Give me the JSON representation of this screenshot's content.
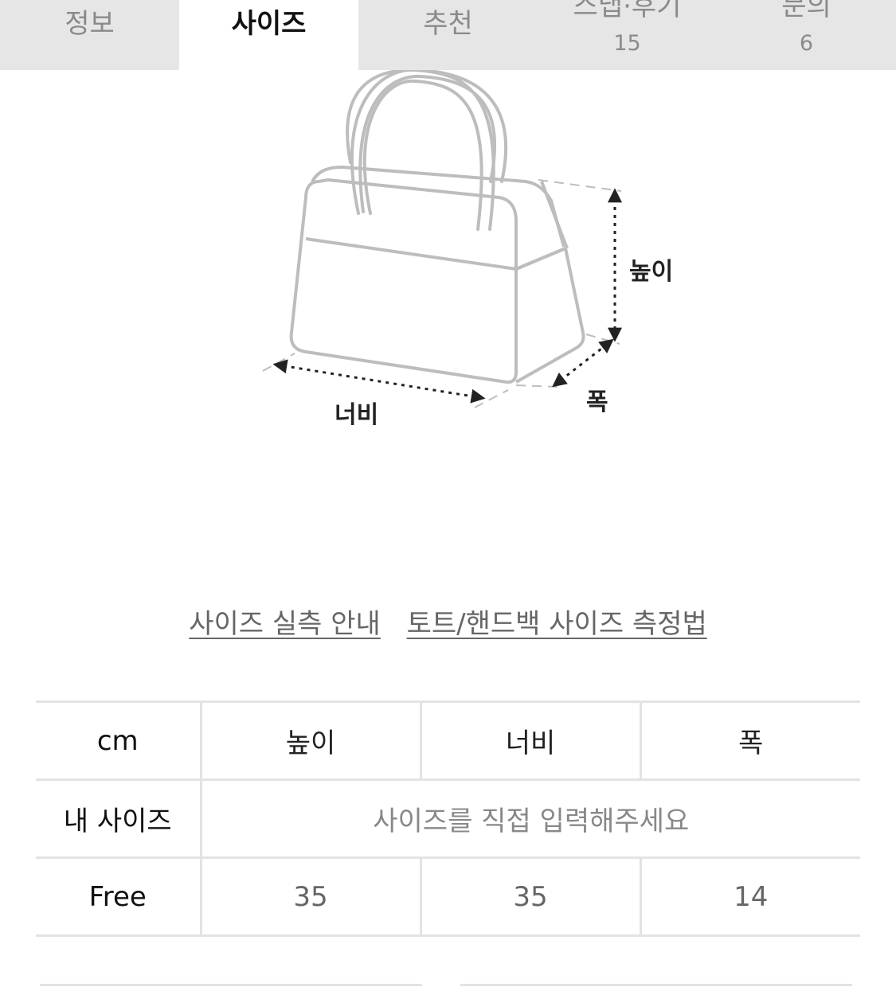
{
  "tabs": [
    {
      "label": "정보",
      "count": ""
    },
    {
      "label": "사이즈",
      "count": "",
      "active": true
    },
    {
      "label": "추천",
      "count": ""
    },
    {
      "label": "스냅·후기",
      "count": "15"
    },
    {
      "label": "문의",
      "count": "6"
    }
  ],
  "diagram": {
    "height_label": "높이",
    "width_label": "너비",
    "depth_label": "폭",
    "line_color": "#bdbdbd",
    "arrow_color": "#222222"
  },
  "links": {
    "guide": "사이즈 실측 안내",
    "method": "토트/핸드백 사이즈 측정법"
  },
  "size_table": {
    "headers": [
      "cm",
      "높이",
      "너비",
      "폭"
    ],
    "my_size": {
      "label": "내 사이즈",
      "placeholder": "사이즈를 직접 입력해주세요"
    },
    "rows": [
      {
        "size": "Free",
        "height": "35",
        "width": "35",
        "depth": "14"
      }
    ]
  }
}
